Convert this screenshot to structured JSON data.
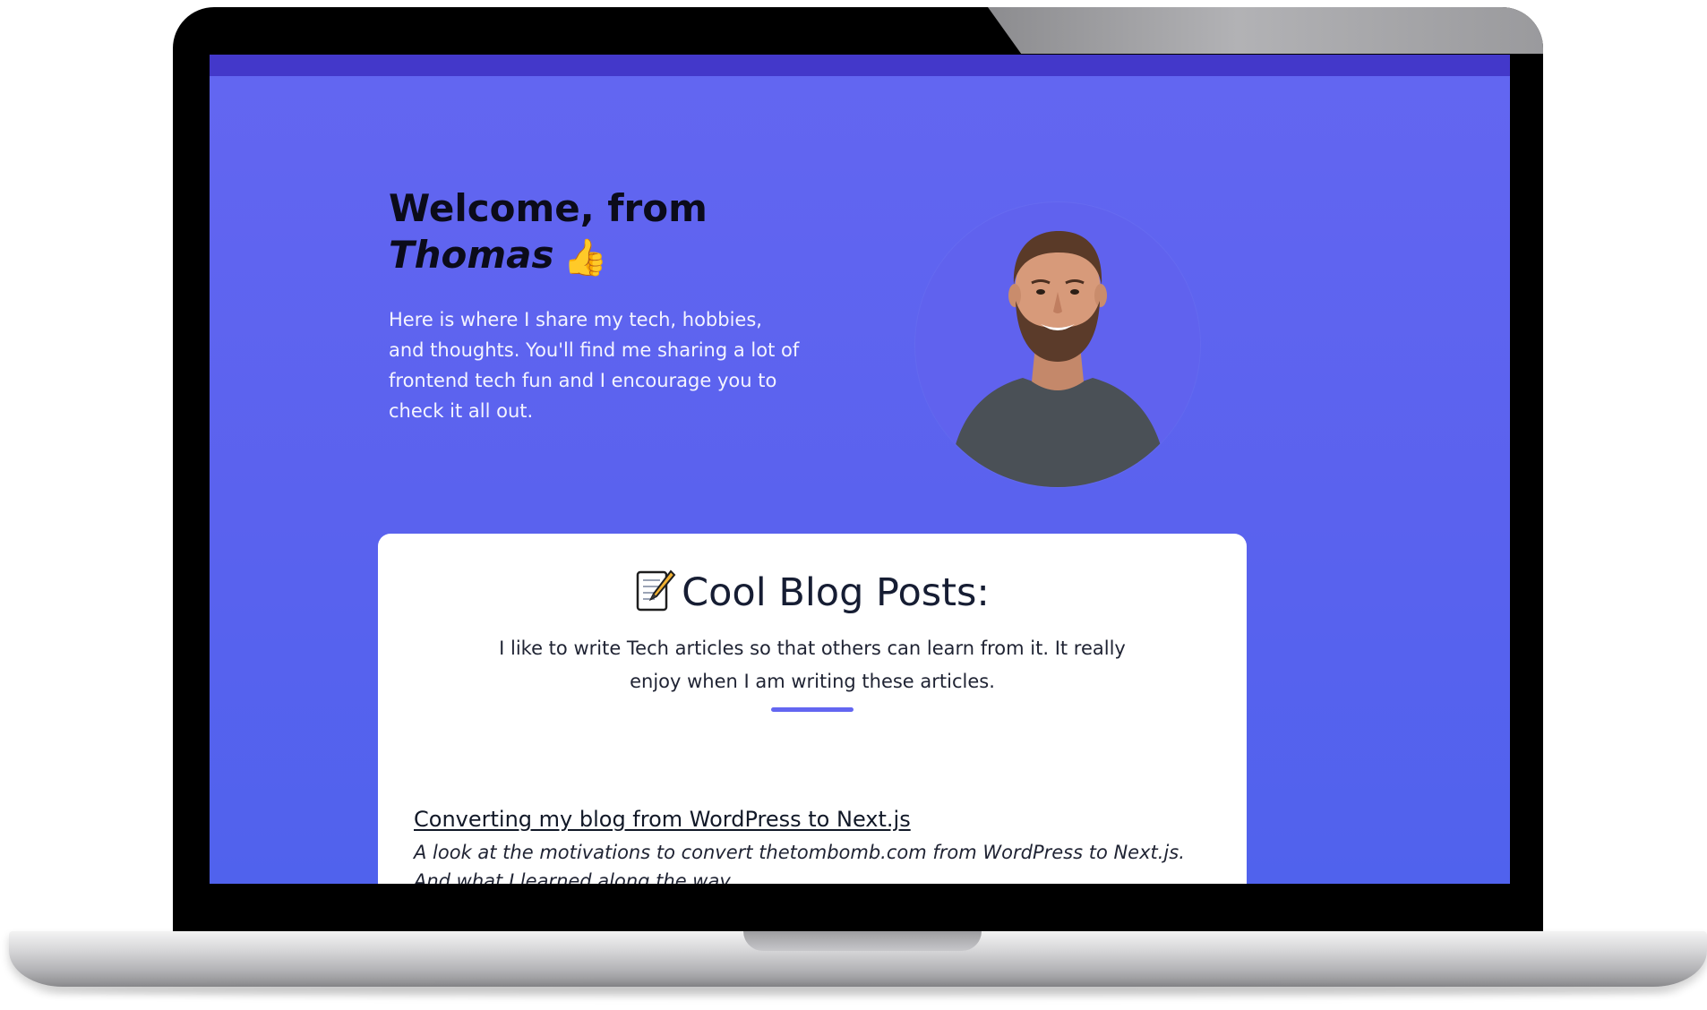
{
  "hero": {
    "title_prefix": "Welcome, from",
    "title_name": "Thomas",
    "title_emoji": "👍",
    "description": "Here is where I share my tech, hobbies, and thoughts. You'll find me sharing a lot of frontend tech fun and I encourage you to check it all out."
  },
  "avatar": {
    "icon": "profile-photo"
  },
  "blog": {
    "heading": "Cool Blog Posts:",
    "heading_icon": "memo-icon",
    "intro": "I like to write Tech articles so that others can learn from it. It really enjoy when I am writing these articles.",
    "posts": [
      {
        "title": "Converting my blog from WordPress to Next.js",
        "description": "A look at the motivations to convert thetombomb.com from WordPress to Next.js. And what I learned along the way."
      }
    ]
  },
  "colors": {
    "brand": "#6366f1",
    "top_bar": "#4338ca",
    "card_bg": "#ffffff",
    "heading_text": "#0b0b1a"
  }
}
